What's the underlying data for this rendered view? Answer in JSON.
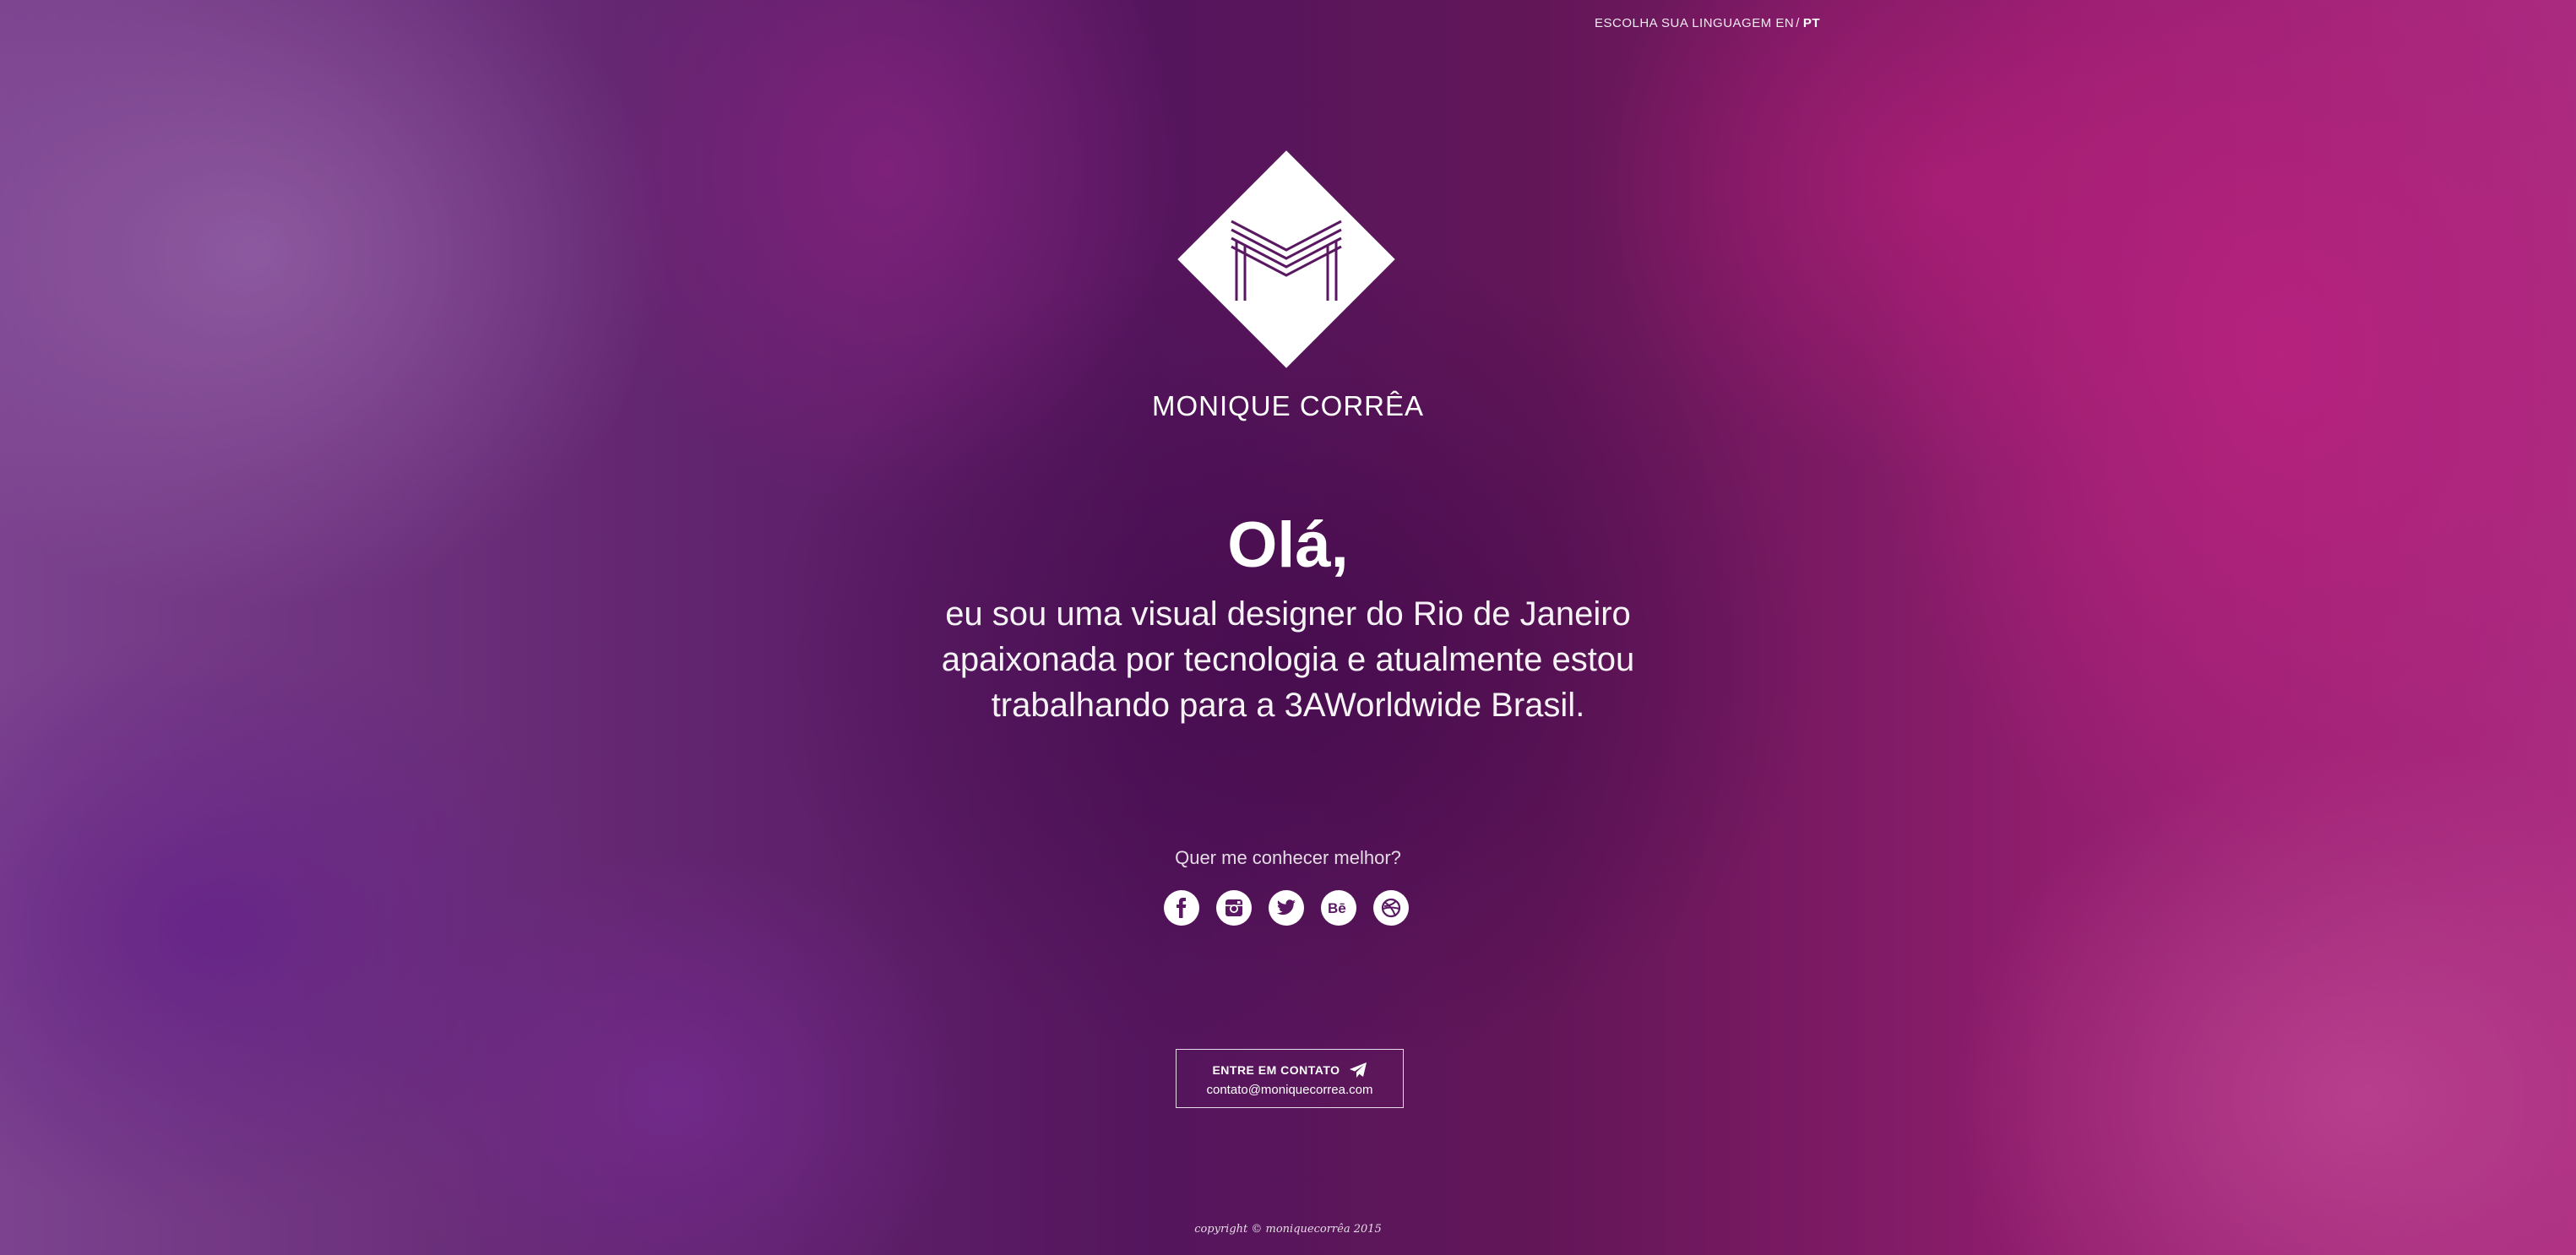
{
  "language": {
    "prompt": "ESCOLHA SUA LINGUAGEM",
    "options": [
      {
        "label": "EN",
        "active": false
      },
      {
        "label": "PT",
        "active": true
      }
    ],
    "separator": "/"
  },
  "brand": {
    "name": "MONIQUE CORRÊA",
    "logo_icon": "diamond-m-logo"
  },
  "hero": {
    "greeting": "Olá,",
    "intro": "eu sou uma visual designer do Rio de Janeiro apaixonada por tecnologia e atualmente estou trabalhando para a 3AWorldwide Brasil."
  },
  "social": {
    "prompt": "Quer me conhecer melhor?",
    "links": [
      {
        "name": "facebook",
        "icon": "facebook-icon"
      },
      {
        "name": "instagram",
        "icon": "instagram-icon"
      },
      {
        "name": "twitter",
        "icon": "twitter-icon"
      },
      {
        "name": "behance",
        "icon": "behance-icon"
      },
      {
        "name": "dribbble",
        "icon": "dribbble-icon"
      }
    ]
  },
  "contact": {
    "label": "ENTRE EM CONTATO",
    "icon": "paper-plane-icon",
    "email": "contato@moniquecorrea.com"
  },
  "footer": {
    "copyright": "copyright © moniquecorrêa 2015"
  },
  "colors": {
    "background_purple": "#5a1862",
    "background_magenta": "#c3328d",
    "foreground": "#ffffff",
    "icon_fill": "#5a1862"
  }
}
